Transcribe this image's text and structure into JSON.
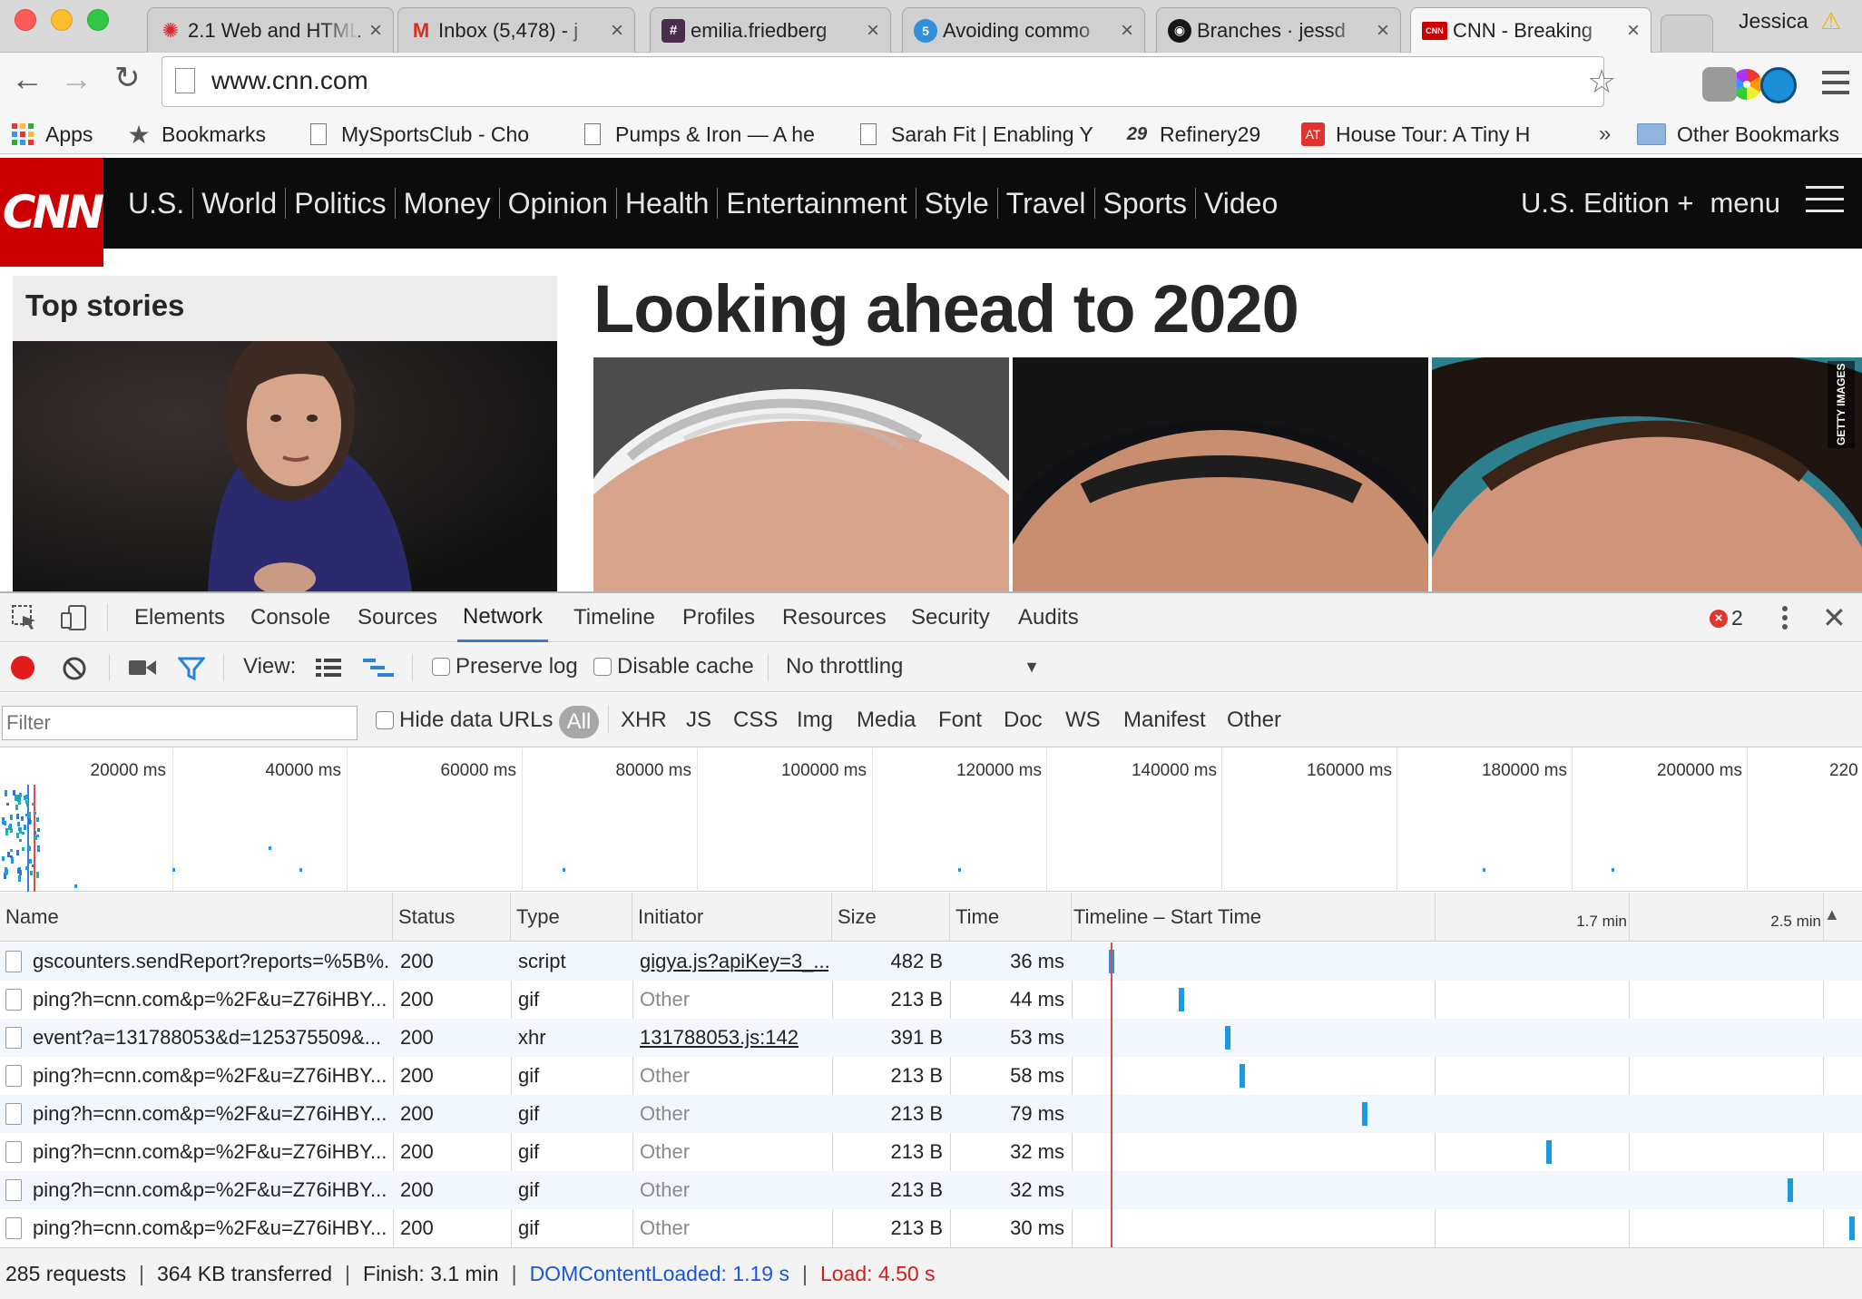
{
  "window": {
    "profile_name": "Jessica",
    "tabs": [
      {
        "title": "2.1 Web and HTML",
        "close": "×"
      },
      {
        "title": "Inbox (5,478) - j",
        "close": "×"
      },
      {
        "title": "emilia.friedberg",
        "close": "×"
      },
      {
        "title": "Avoiding commo",
        "close": "×"
      },
      {
        "title": "Branches · jessd",
        "close": "×"
      },
      {
        "title": "CNN - Breaking",
        "close": "×"
      }
    ],
    "url": "www.cnn.com",
    "bookmarks": [
      {
        "label": "Apps",
        "icon": "apps-grid-icon"
      },
      {
        "label": "Bookmarks",
        "icon": "star-icon"
      },
      {
        "label": "MySportsClub - Cho",
        "icon": "page-icon"
      },
      {
        "label": "Pumps & Iron — A he",
        "icon": "page-icon"
      },
      {
        "label": "Sarah Fit | Enabling Y",
        "icon": "page-icon"
      },
      {
        "label": "Refinery29",
        "icon": "refinery29-icon"
      },
      {
        "label": "House Tour: A Tiny H",
        "icon": "apartment-therapy-icon"
      }
    ],
    "bookmarks_overflow": "»",
    "other_bookmarks": "Other Bookmarks"
  },
  "page": {
    "logo": "CNN",
    "nav": [
      "U.S.",
      "World",
      "Politics",
      "Money",
      "Opinion",
      "Health",
      "Entertainment",
      "Style",
      "Travel",
      "Sports",
      "Video"
    ],
    "edition": "U.S. Edition +",
    "menu": "menu",
    "top_stories": "Top stories",
    "headline": "Looking ahead to 2020",
    "photo_credit": "GETTY IMAGES"
  },
  "devtools": {
    "tabs": [
      "Elements",
      "Console",
      "Sources",
      "Network",
      "Timeline",
      "Profiles",
      "Resources",
      "Security",
      "Audits"
    ],
    "active_tab": "Network",
    "error_count": "2",
    "view_label": "View:",
    "preserve_log": "Preserve log",
    "disable_cache": "Disable cache",
    "throttling": "No throttling",
    "filter_placeholder": "Filter",
    "hide_data_urls": "Hide data URLs",
    "type_filters": [
      "All",
      "XHR",
      "JS",
      "CSS",
      "Img",
      "Media",
      "Font",
      "Doc",
      "WS",
      "Manifest",
      "Other"
    ],
    "active_type_filter": "All",
    "overview_ticks": [
      "20000 ms",
      "40000 ms",
      "60000 ms",
      "80000 ms",
      "100000 ms",
      "120000 ms",
      "140000 ms",
      "160000 ms",
      "180000 ms",
      "200000 ms",
      "220"
    ],
    "columns": [
      "Name",
      "Status",
      "Type",
      "Initiator",
      "Size",
      "Time",
      "Timeline – Start Time"
    ],
    "timeline_marks": [
      "1.7 min",
      "2.5 min"
    ],
    "sort_indicator": "▲",
    "colors": {
      "accent": "#3879d9",
      "bar": "#1a9ae0",
      "error": "#e0362c",
      "record": "#e21b1b"
    },
    "requests": [
      {
        "name": "gscounters.sendReport?reports=%5B%...",
        "status": "200",
        "type": "script",
        "initiator": "gigya.js?apiKey=3_...",
        "initiator_link": true,
        "size": "482 B",
        "time": "36 ms",
        "start_frac": 0.048
      },
      {
        "name": "ping?h=cnn.com&p=%2F&u=Z76iHBY...",
        "status": "200",
        "type": "gif",
        "initiator": "Other",
        "initiator_link": false,
        "size": "213 B",
        "time": "44 ms",
        "start_frac": 0.137
      },
      {
        "name": "event?a=131788053&d=125375509&...",
        "status": "200",
        "type": "xhr",
        "initiator": "131788053.js:142",
        "initiator_link": true,
        "size": "391 B",
        "time": "53 ms",
        "start_frac": 0.197
      },
      {
        "name": "ping?h=cnn.com&p=%2F&u=Z76iHBY...",
        "status": "200",
        "type": "gif",
        "initiator": "Other",
        "initiator_link": false,
        "size": "213 B",
        "time": "58 ms",
        "start_frac": 0.215
      },
      {
        "name": "ping?h=cnn.com&p=%2F&u=Z76iHBY...",
        "status": "200",
        "type": "gif",
        "initiator": "Other",
        "initiator_link": false,
        "size": "213 B",
        "time": "79 ms",
        "start_frac": 0.372
      },
      {
        "name": "ping?h=cnn.com&p=%2F&u=Z76iHBY...",
        "status": "200",
        "type": "gif",
        "initiator": "Other",
        "initiator_link": false,
        "size": "213 B",
        "time": "32 ms",
        "start_frac": 0.608
      },
      {
        "name": "ping?h=cnn.com&p=%2F&u=Z76iHBY...",
        "status": "200",
        "type": "gif",
        "initiator": "Other",
        "initiator_link": false,
        "size": "213 B",
        "time": "32 ms",
        "start_frac": 0.918
      },
      {
        "name": "ping?h=cnn.com&p=%2F&u=Z76iHBY...",
        "status": "200",
        "type": "gif",
        "initiator": "Other",
        "initiator_link": false,
        "size": "213 B",
        "time": "30 ms",
        "start_frac": 0.996
      }
    ],
    "summary": {
      "requests": "285 requests",
      "transferred": "364 KB transferred",
      "finish": "Finish: 3.1 min",
      "dom_content_loaded": "DOMContentLoaded: 1.19 s",
      "load": "Load: 4.50 s"
    }
  }
}
